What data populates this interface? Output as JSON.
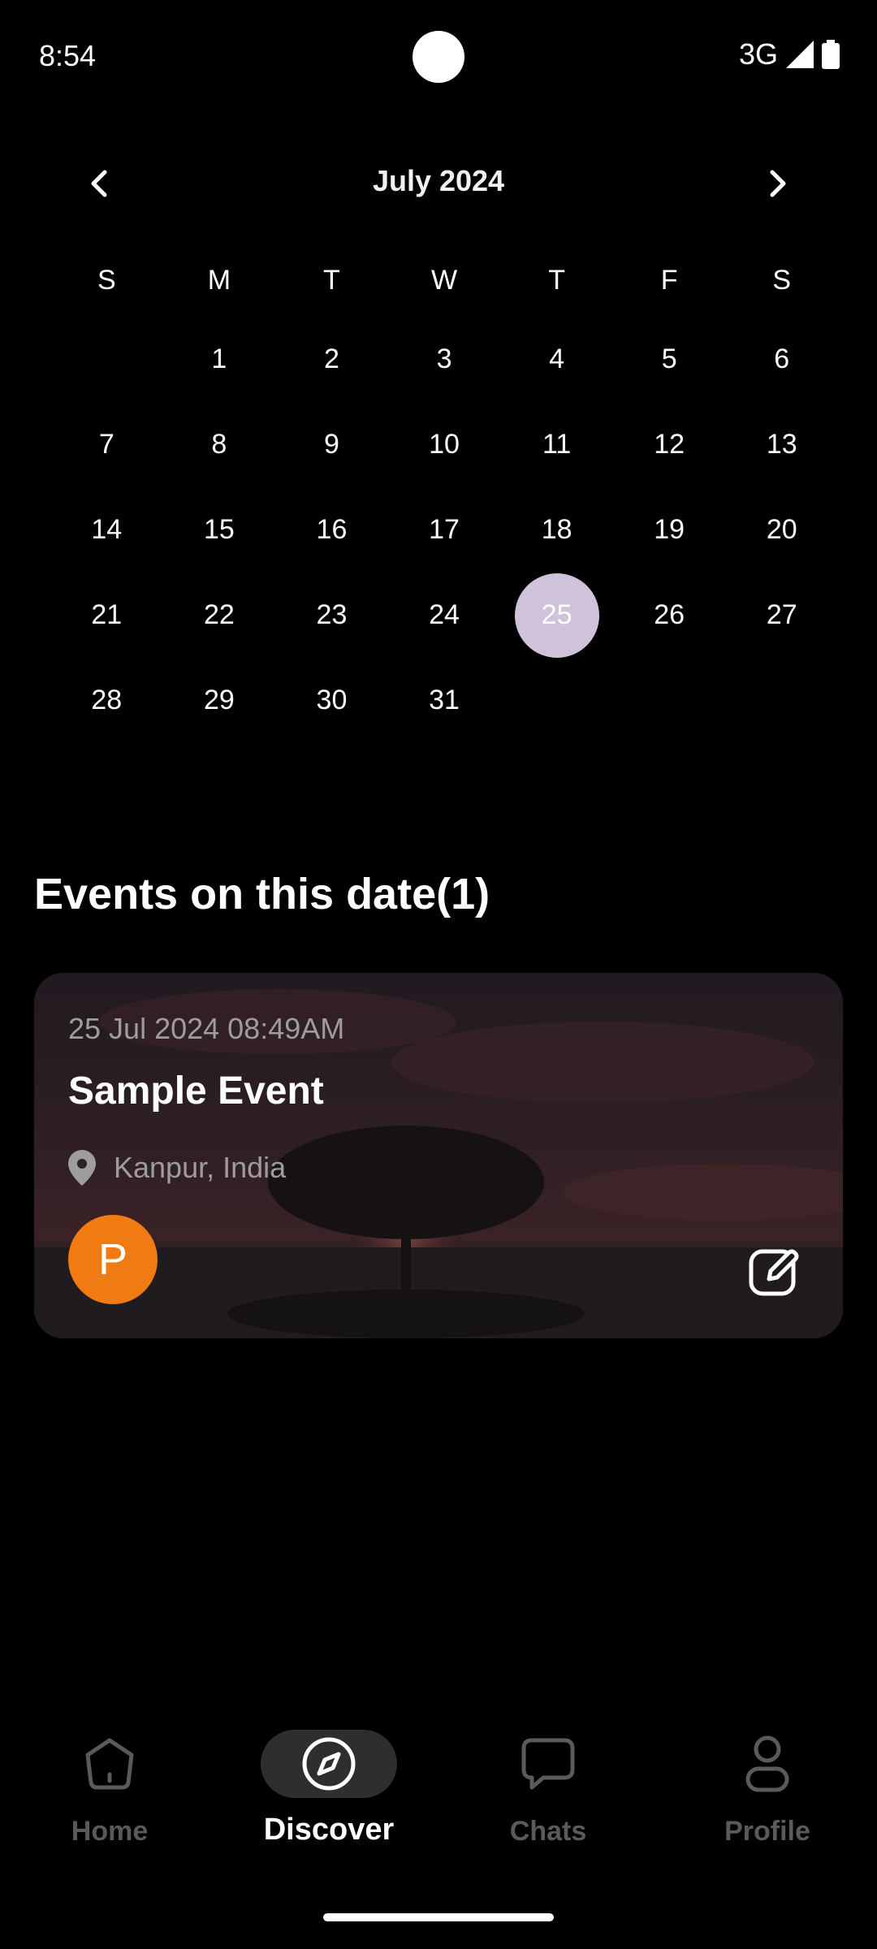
{
  "status_bar": {
    "time": "8:54",
    "network": "3G"
  },
  "calendar": {
    "month_label": "July 2024",
    "weekdays": [
      "S",
      "M",
      "T",
      "W",
      "T",
      "F",
      "S"
    ],
    "weeks": [
      [
        "",
        "1",
        "2",
        "3",
        "4",
        "5",
        "6"
      ],
      [
        "7",
        "8",
        "9",
        "10",
        "11",
        "12",
        "13"
      ],
      [
        "14",
        "15",
        "16",
        "17",
        "18",
        "19",
        "20"
      ],
      [
        "21",
        "22",
        "23",
        "24",
        "25",
        "26",
        "27"
      ],
      [
        "28",
        "29",
        "30",
        "31",
        "",
        "",
        ""
      ]
    ],
    "selected_day": "25",
    "selected_color": "#cfc3dc"
  },
  "events": {
    "title": "Events on this date(1)",
    "items": [
      {
        "datetime": "25 Jul 2024 08:49AM",
        "name": "Sample Event",
        "location": "Kanpur, India",
        "avatar_initial": "P",
        "avatar_color": "#f07b12"
      }
    ]
  },
  "bottom_nav": {
    "items": [
      {
        "label": "Home",
        "icon": "home-icon",
        "active": false
      },
      {
        "label": "Discover",
        "icon": "compass-icon",
        "active": true
      },
      {
        "label": "Chats",
        "icon": "chat-icon",
        "active": false
      },
      {
        "label": "Profile",
        "icon": "profile-icon",
        "active": false
      }
    ]
  }
}
